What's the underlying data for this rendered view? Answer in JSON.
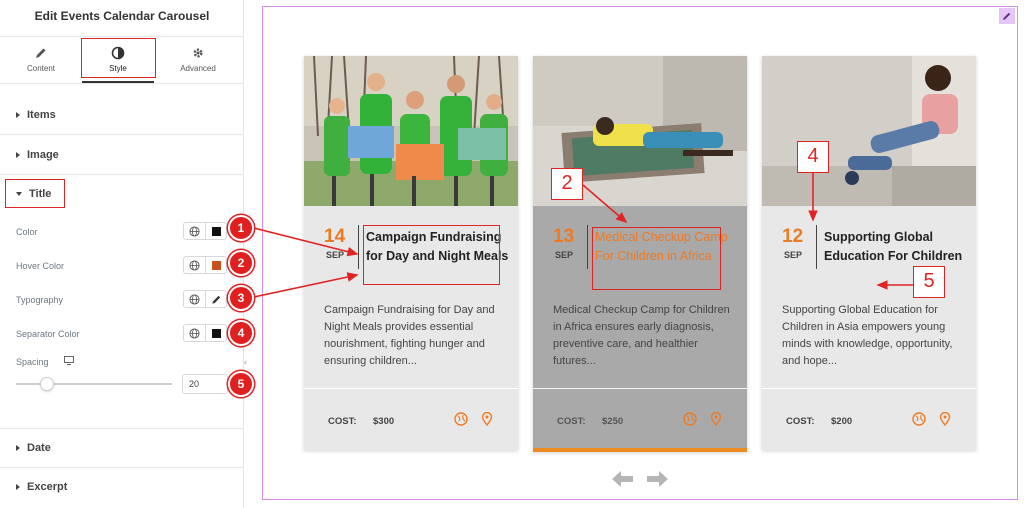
{
  "panel": {
    "title": "Edit Events Calendar Carousel",
    "tabs": [
      {
        "label": "Content",
        "icon": "pencil-icon"
      },
      {
        "label": "Style",
        "icon": "contrast-icon"
      },
      {
        "label": "Advanced",
        "icon": "gear-icon"
      }
    ],
    "sections": {
      "items": "Items",
      "image": "Image",
      "title": "Title",
      "date": "Date",
      "excerpt": "Excerpt"
    },
    "controls": {
      "color": "Color",
      "hover_color": "Hover Color",
      "typography": "Typography",
      "separator_color": "Separator Color",
      "spacing": "Spacing",
      "spacing_value": "20",
      "spacing_slider_fraction": 0.2
    },
    "swatches": {
      "color": "#111111",
      "hover_color": "#c8501e",
      "separator_color": "#111111"
    },
    "badges": [
      "1",
      "2",
      "3",
      "4",
      "5"
    ]
  },
  "preview": {
    "cards": [
      {
        "day": "14",
        "month": "SEP",
        "title": "Campaign Fundraising for Day and Night Meals",
        "excerpt": "Campaign Fundraising for Day and Night Meals provides essential nourishment, fighting hunger and ensuring children...",
        "cost_label": "COST:",
        "cost": "$300"
      },
      {
        "day": "13",
        "month": "SEP",
        "title": "Medical Checkup Camp For Children in Africa",
        "excerpt": "Medical Checkup Camp for Children in Africa ensures early diagnosis, preventive care, and healthier futures...",
        "cost_label": "COST:",
        "cost": "$250"
      },
      {
        "day": "12",
        "month": "SEP",
        "title": "Supporting Global Education For Children",
        "excerpt": "Supporting Global Education for Children in Asia empowers young minds with knowledge, opportunity, and hope...",
        "cost_label": "COST:",
        "cost": "$200"
      }
    ],
    "annotations": [
      "2",
      "4",
      "5"
    ],
    "accent_color": "#ee7a22",
    "annotation_color": "#e02424"
  }
}
